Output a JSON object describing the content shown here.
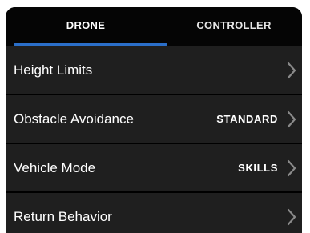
{
  "tabs": [
    {
      "label": "DRONE",
      "selected": true
    },
    {
      "label": "CONTROLLER",
      "selected": false
    }
  ],
  "accent_color": "#2b6fc9",
  "settings": [
    {
      "label": "Height Limits",
      "value": "",
      "icon": "chevron-right-icon"
    },
    {
      "label": "Obstacle Avoidance",
      "value": "STANDARD",
      "icon": "chevron-right-icon"
    },
    {
      "label": "Vehicle Mode",
      "value": "SKILLS",
      "icon": "chevron-right-icon"
    },
    {
      "label": "Return Behavior",
      "value": "",
      "icon": "chevron-right-icon"
    }
  ]
}
